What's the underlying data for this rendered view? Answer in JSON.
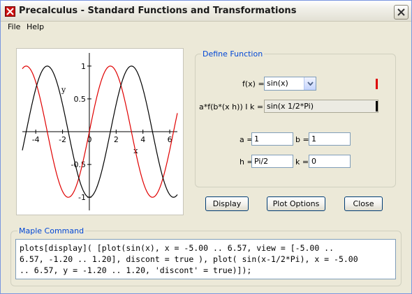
{
  "window": {
    "title": "Precalculus - Standard Functions and Transformations"
  },
  "menu": [
    "File",
    "Help"
  ],
  "plot": {
    "x_ticks": [
      "-4",
      "-2",
      "0",
      "2",
      "4",
      "6"
    ],
    "y_ticks": [
      "1",
      "0.5",
      "-0.5",
      "-1"
    ],
    "x_label": "x",
    "y_label": "y"
  },
  "define": {
    "group_title": "Define Function",
    "fx_label": "f(x) =",
    "fx_value": "sin(x)",
    "transform_label": "a*f(b*(x h)) I k =",
    "transform_value": "sin(x 1/2*Pi)",
    "a_label": "a =",
    "a_value": "1",
    "b_label": "b =",
    "b_value": "1",
    "h_label": "h =",
    "h_value": "Pi/2",
    "k_label": "k =",
    "k_value": "0"
  },
  "buttons": {
    "display": "Display",
    "plot_options": "Plot Options",
    "close": "Close"
  },
  "maple": {
    "group_title": "Maple Command",
    "lines": [
      "plots[display]( [plot(sin(x), x = -5.00 .. 6.57, view = [-5.00 ..",
      "6.57, -1.20 .. 1.20], discont = true ), plot( sin(x-1/2*Pi), x = -5.00",
      ".. 6.57, y = -1.20 .. 1.20, 'discont' = true)]);"
    ]
  },
  "chart_data": {
    "type": "line",
    "xlim": [
      -5.0,
      6.57
    ],
    "ylim": [
      -1.2,
      1.2
    ],
    "series": [
      {
        "color": "#e00000",
        "function": "sin(x)"
      },
      {
        "color": "#000000",
        "function": "sin(x-1/2*Pi)"
      }
    ]
  },
  "colors": {
    "marker_red": "#dd0000",
    "marker_black": "#000000",
    "group_title": "#0046d5"
  }
}
